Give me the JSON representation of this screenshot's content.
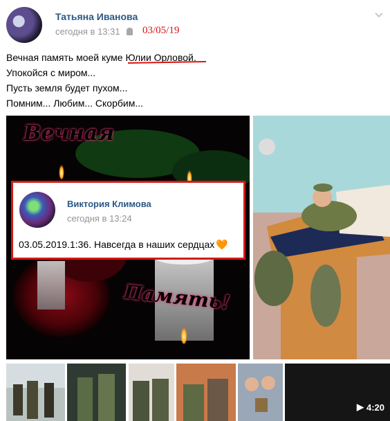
{
  "post": {
    "author": "Татьяна Иванова",
    "time": "сегодня в 13:31",
    "handwritten_date": "03/05/19",
    "lines": [
      "Вечная память моей куме Юлии Орловой.",
      "Упокойся с миром...",
      "Пусть земля будет пухом...",
      "Помним... Любим... Скорбим..."
    ]
  },
  "main_image": {
    "title_top": "Вечная",
    "title_bottom": "Память!"
  },
  "overlay": {
    "author": "Виктория Климова",
    "time": "сегодня в 13:24",
    "text": "03.05.2019.1:36. Навсегда в наших сердцах",
    "emoji": "🧡"
  },
  "video": {
    "duration": "4:20"
  },
  "colors": {
    "link": "#2a5885",
    "muted": "#939393",
    "annotation": "#d11"
  }
}
